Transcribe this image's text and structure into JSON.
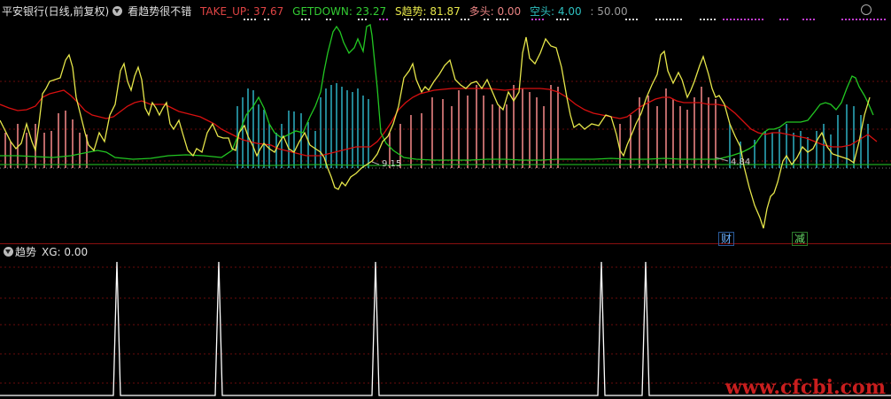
{
  "colors": {
    "red": "#d81010",
    "green": "#22c722",
    "yellow": "#e6e64a",
    "cyan": "#2aa6b8",
    "pink": "#e98383",
    "white": "#ffffff",
    "magenta": "#c03ad0"
  },
  "main_panel": {
    "stock": "平安银行(日线,前复权)",
    "indicator": "看趋势很不错",
    "take_up_label": "TAKE_UP: 37.67",
    "getdown_label": "GETDOWN: 23.27",
    "s_trend_label": "S趋势: 81.87",
    "duotou_label": "多头: 0.00",
    "kongtou_label": "空头: 4.00",
    "level_label": ": 50.00",
    "low_tag1": "9.15",
    "low_tag2": "4.84",
    "badge_cai": "财",
    "badge_jian": "减"
  },
  "sub_panel": {
    "title": "趋势",
    "xg_label": "XG: 0.00"
  },
  "watermark": "www.cfcbi.com",
  "xg_signal": {
    "spike_x_fraction": [
      0.131,
      0.246,
      0.421,
      0.675,
      0.725
    ],
    "value": 0
  },
  "icons": [
    "dropdown-icon",
    "maximize-icon"
  ]
}
